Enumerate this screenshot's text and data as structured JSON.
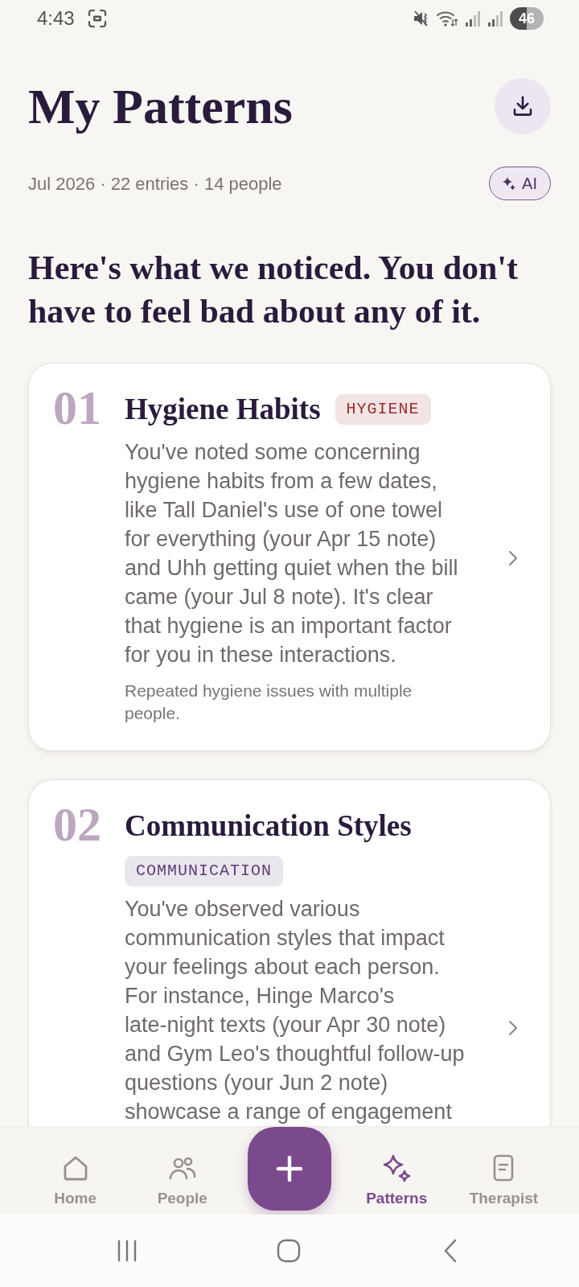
{
  "status_bar": {
    "time": "4:43",
    "battery": "46"
  },
  "header": {
    "title": "My Patterns",
    "summary": "Jul 2026 · 22 entries · 14 people",
    "ai_label": "AI"
  },
  "intro": "Here's what we noticed. You don't have to feel bad about any of it.",
  "patterns": [
    {
      "number": "01",
      "title": "Hygiene Habits",
      "tag": {
        "label": "HYGIENE",
        "color": "#9b2c2c"
      },
      "body": "You've noted some concerning hygiene habits from a few dates, like Tall Daniel's use of one towel for everything (your Apr 15 note) and Uhh getting quiet when the bill came (your Jul 8 note). It's clear that hygiene is an important factor for you in these interactions.",
      "note": "Repeated hygiene issues with multiple people."
    },
    {
      "number": "02",
      "title": "Communication Styles",
      "tag": {
        "label": "COMMUNICATION",
        "color": "#5b3d78"
      },
      "body": "You've observed various communication styles that impact your feelings about each person. For instance, Hinge Marco's late-night texts (your Apr 30 note) and Gym Leo's thoughtful follow-up questions (your Jun 2 note) showcase a range of engagement"
    }
  ],
  "bottom_nav": [
    {
      "label": "Home",
      "selected": false
    },
    {
      "label": "People",
      "selected": false
    },
    {
      "label": "Patterns",
      "selected": true
    },
    {
      "label": "Therapist",
      "selected": false
    }
  ]
}
